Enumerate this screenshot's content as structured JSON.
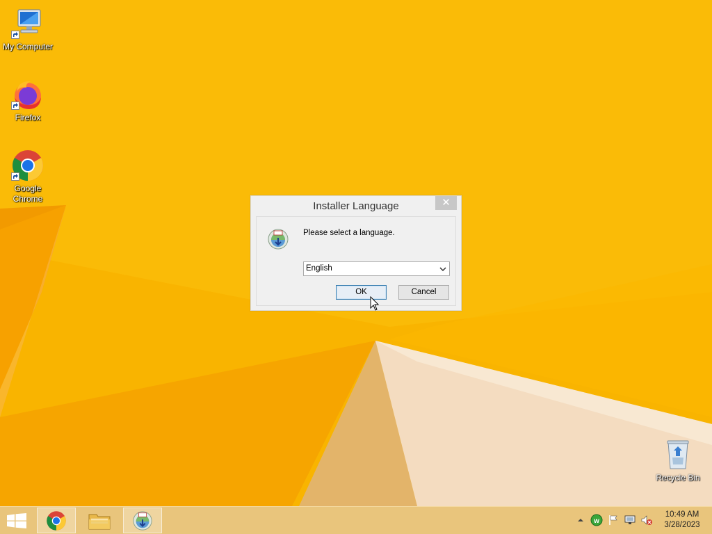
{
  "desktop": {
    "icons": [
      {
        "label": "My Computer",
        "icon": "computer-icon"
      },
      {
        "label": "Firefox",
        "icon": "firefox-icon"
      },
      {
        "label": "Google Chrome",
        "icon": "chrome-icon"
      },
      {
        "label": "Recycle Bin",
        "icon": "recycle-bin-icon"
      }
    ]
  },
  "dialog": {
    "title": "Installer Language",
    "close_label": "✕",
    "prompt": "Please select a language.",
    "language_select": {
      "selected": "English"
    },
    "ok_label": "OK",
    "cancel_label": "Cancel"
  },
  "taskbar": {
    "start_icon": "windows-logo-icon",
    "pinned": [
      {
        "name": "Google Chrome",
        "icon": "chrome-icon",
        "active": true
      },
      {
        "name": "File Explorer",
        "icon": "folder-icon",
        "active": false
      },
      {
        "name": "Installer",
        "icon": "installer-icon",
        "active": true
      }
    ],
    "tray": {
      "icons": [
        "chevron-up-icon",
        "green-w-icon",
        "flag-icon",
        "network-icon",
        "volume-muted-icon"
      ],
      "time": "10:49 AM",
      "date": "3/28/2023"
    }
  },
  "colors": {
    "wallpaper": "#f8b300",
    "taskbar": "#e9c57c",
    "dialog_bg": "#f0f0f0",
    "ok_border": "#3c7fb1"
  }
}
